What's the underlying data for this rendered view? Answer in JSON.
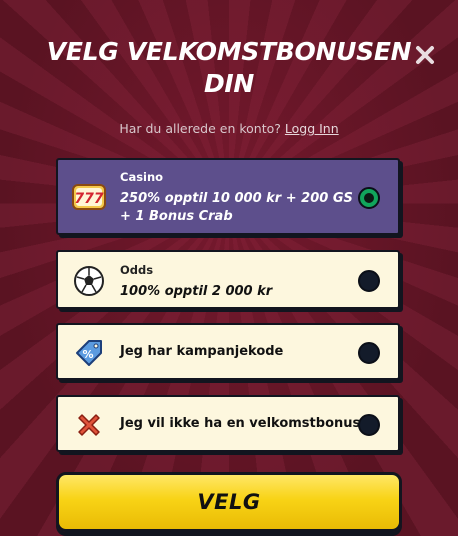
{
  "header": {
    "title": "VELG VELKOMSTBONUSEN DIN",
    "close_icon": "close-icon"
  },
  "login": {
    "prompt": "Har du allerede en konto?",
    "link": "Logg Inn"
  },
  "options": [
    {
      "id": "casino",
      "category": "Casino",
      "description": "250% opptil 10 000 kr + 200 GS + 1 Bonus Crab",
      "icon": "slot-777-icon",
      "selected": true
    },
    {
      "id": "odds",
      "category": "Odds",
      "description": "100% opptil 2 000 kr",
      "icon": "soccer-ball-icon",
      "selected": false
    },
    {
      "id": "promo",
      "label": "Jeg har kampanjekode",
      "icon": "percent-tag-icon",
      "selected": false
    },
    {
      "id": "none",
      "label": "Jeg vil ikke ha en velkomstbonus",
      "icon": "red-x-icon",
      "selected": false
    }
  ],
  "cta": {
    "label": "VELG"
  },
  "colors": {
    "background": "#5e1424",
    "selected_card": "#5d4f8c",
    "card": "#fdf7de",
    "radio_on": "#11a55c",
    "cta": "#f8d316"
  }
}
